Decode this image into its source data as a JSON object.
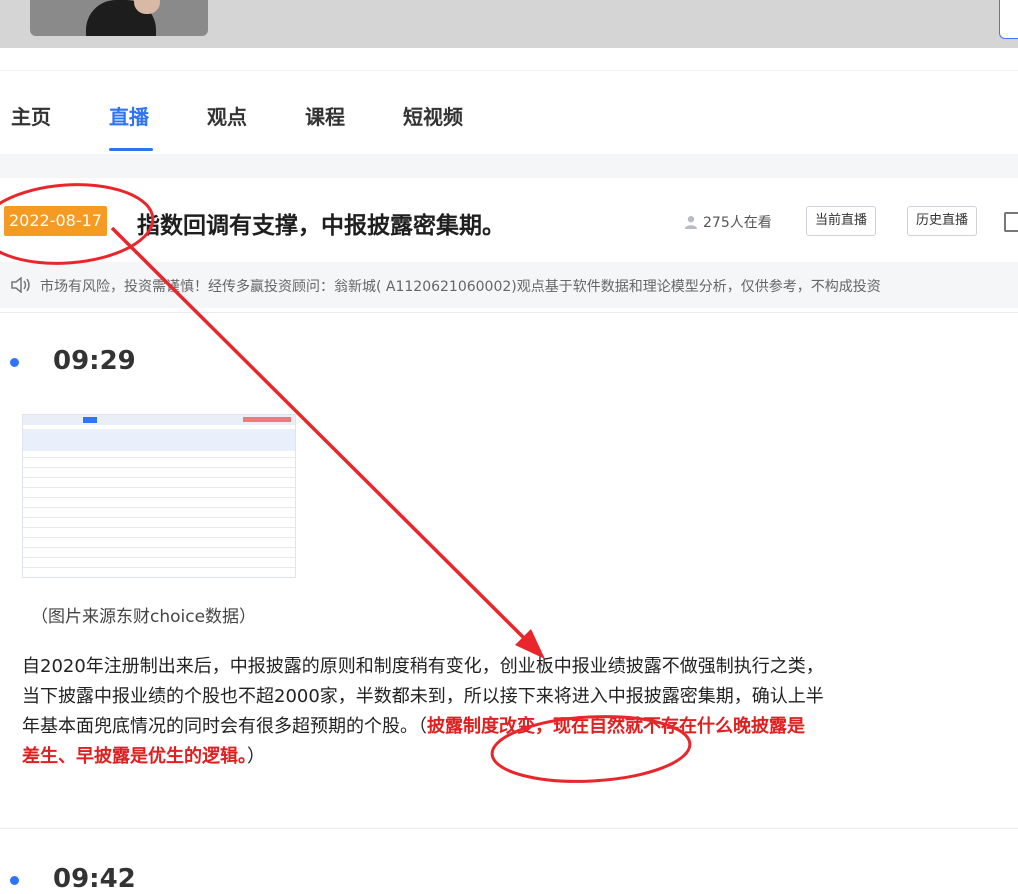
{
  "nav": {
    "tabs": [
      {
        "label": "主页"
      },
      {
        "label": "直播",
        "active": true
      },
      {
        "label": "观点"
      },
      {
        "label": "课程"
      },
      {
        "label": "短视频"
      }
    ]
  },
  "live": {
    "date": "2022-08-17",
    "title": "指数回调有支撑，中报披露密集期。",
    "viewers": "275人在看",
    "current_button": "当前直播",
    "history_button": "历史直播"
  },
  "risk_notice": "市场有风险，投资需谨慎！经传多赢投资顾问：翁新城( A1120621060002)观点基于软件数据和理论模型分析，仅供参考，不构成投资",
  "posts": [
    {
      "time": "09:29",
      "caption": "（图片来源东财choice数据）",
      "paragraph_lines": [
        "自2020年注册制出来后，中报披露的原则和制度稍有变化，创业板中报业绩披露不做强制执行之类，",
        "当下披露中报业绩的个股也不超2000家，半数都未到，所以接下来将进入中报披露密集期，确认上半",
        "年基本面兜底情况的同时会有很多超预期的个股。（"
      ],
      "highlight_a": "披露制度改变，现在自然就不存在什么晚披露是",
      "highlight_b": "差生、早披露是优生的逻辑。",
      "paragraph_tail": "）"
    },
    {
      "time": "09:42"
    }
  ],
  "colors": {
    "accent": "#2f74f3",
    "date_badge": "#f59a23",
    "highlight": "#e02020",
    "annotation": "#e8262b"
  }
}
